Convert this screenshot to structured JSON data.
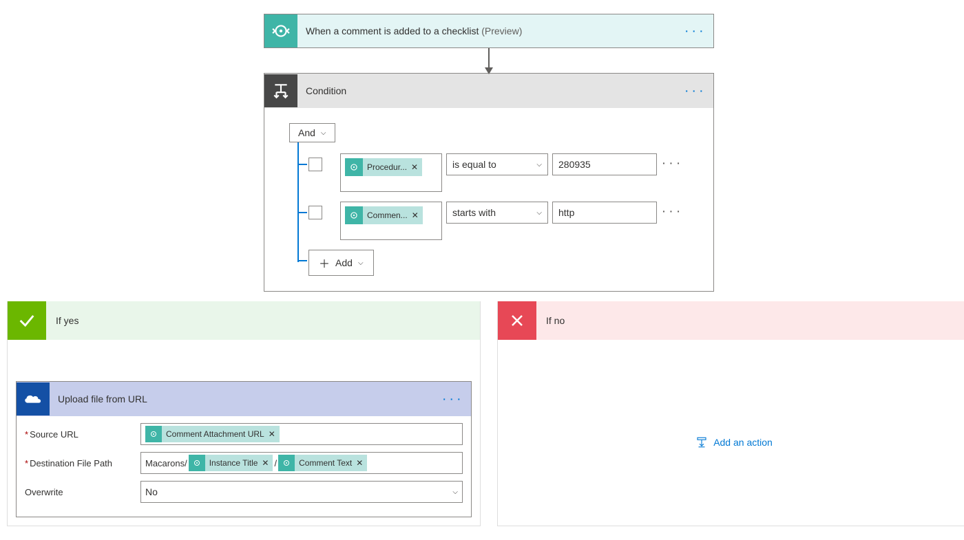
{
  "trigger": {
    "title": "When a comment is added to a checklist",
    "badge": "(Preview)"
  },
  "condition": {
    "title": "Condition",
    "group_operator": "And",
    "add_label": "Add",
    "rows": [
      {
        "token": "Procedur...",
        "operator": "is equal to",
        "value": "280935"
      },
      {
        "token": "Commen...",
        "operator": "starts with",
        "value": "http"
      }
    ]
  },
  "branches": {
    "yes_label": "If yes",
    "no_label": "If no",
    "add_action_label": "Add an action"
  },
  "upload_action": {
    "title": "Upload file from URL",
    "fields": {
      "source_url_label": "Source URL",
      "dest_label": "Destination File Path",
      "overwrite_label": "Overwrite",
      "overwrite_value": "No"
    },
    "source_token": "Comment Attachment URL",
    "dest_prefix": "Macarons/",
    "dest_token1": "Instance Title",
    "dest_sep": "/",
    "dest_token2": "Comment Text"
  }
}
